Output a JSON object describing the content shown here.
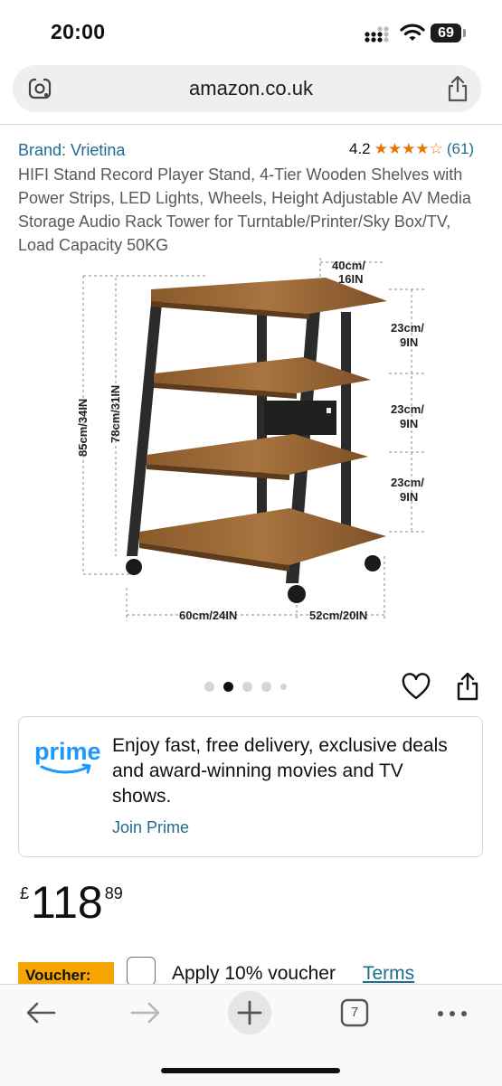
{
  "status_bar": {
    "time": "20:00",
    "battery": "69"
  },
  "browser": {
    "url": "amazon.co.uk",
    "tab_count": "7"
  },
  "product": {
    "brand": "Brand: Vrietina",
    "rating": "4.2",
    "stars": "★★★★☆",
    "review_count": "(61)",
    "title": "HIFI Stand Record Player Stand, 4-Tier Wooden Shelves with Power Strips, LED Lights, Wheels, Height Adjustable AV Media Storage Audio Rack Tower for Turntable/Printer/Sky Box/TV, Load Capacity 50KG"
  },
  "image": {
    "dim_top_a": "40cm/",
    "dim_top_b": "16IN",
    "dim_shelf1_a": "23cm/",
    "dim_shelf1_b": "9IN",
    "dim_shelf2_a": "23cm/",
    "dim_shelf2_b": "9IN",
    "dim_shelf3_a": "23cm/",
    "dim_shelf3_b": "9IN",
    "dim_height_total": "85cm/34IN",
    "dim_height_inner": "78cm/31IN",
    "dim_width": "60cm/24IN",
    "dim_depth": "52cm/20IN",
    "carousel_total": 5,
    "carousel_active": 2
  },
  "prime": {
    "logo_text": "prime",
    "message": "Enjoy fast, free delivery, exclusive deals and award-winning movies and TV shows.",
    "join_label": "Join Prime"
  },
  "price": {
    "currency": "£",
    "whole": "118",
    "fraction": "89"
  },
  "voucher": {
    "badge": "Voucher:",
    "apply_text": "Apply 10% voucher",
    "terms_link": "Terms"
  },
  "colors": {
    "link": "#1f6c8f",
    "star": "#e77600",
    "voucher": "#f6a400",
    "prime_blue": "#1a98ff"
  }
}
